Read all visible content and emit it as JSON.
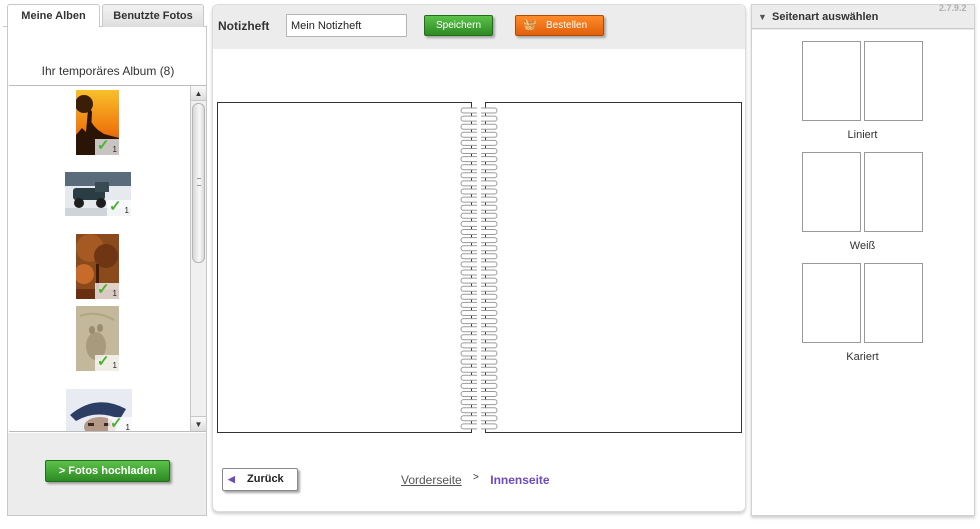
{
  "left_panel": {
    "tabs": [
      {
        "label": "Meine Alben",
        "active": true
      },
      {
        "label": "Benutzte Fotos",
        "active": false
      }
    ],
    "album_title": "Ihr temporäres Album (8)",
    "photos": [
      {
        "name": "sunset-tree",
        "count": "1",
        "used": true
      },
      {
        "name": "vintage-car",
        "count": "1",
        "used": true
      },
      {
        "name": "autumn-tree",
        "count": "1",
        "used": true
      },
      {
        "name": "sand-footprint",
        "count": "1",
        "used": true
      },
      {
        "name": "portrait-hat",
        "count": "1",
        "used": true
      }
    ],
    "upload_button": "> Fotos hochladen"
  },
  "center": {
    "notebook_label": "Notizheft",
    "notebook_name": "Mein Notizheft",
    "save_button": "Speichern",
    "order_button": "Bestellen",
    "back_button": "Zurück",
    "breadcrumb": {
      "front": "Vorderseite",
      "separator": ">",
      "inner": "Innenseite"
    }
  },
  "right_panel": {
    "title": "Seitenart auswählen",
    "version": "2.7.9.2",
    "page_types": [
      {
        "label": "Liniert",
        "pattern": "lined"
      },
      {
        "label": "Weiß",
        "pattern": "blank"
      },
      {
        "label": "Kariert",
        "pattern": "grid"
      }
    ]
  },
  "colors": {
    "green_button": "#3aa22e",
    "orange_button": "#f07414",
    "accent_purple": "#6d4bbf",
    "check_green": "#45b52e"
  }
}
